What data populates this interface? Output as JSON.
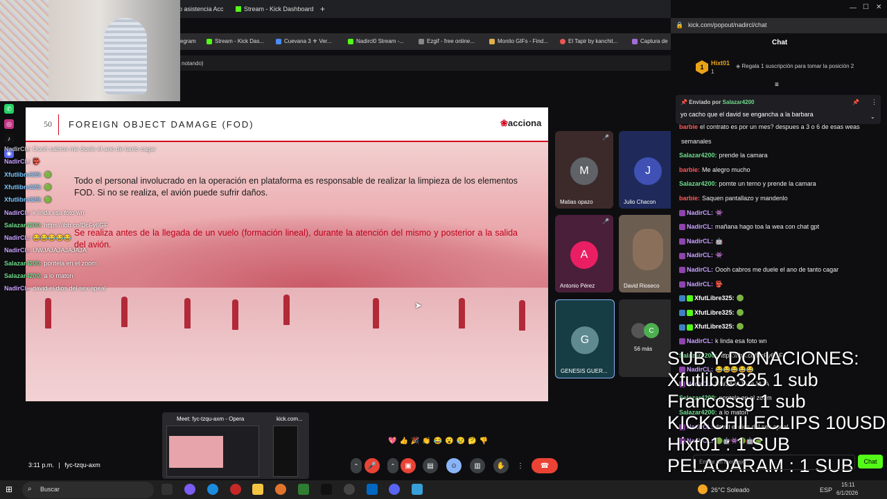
{
  "browser": {
    "tabs": [
      "o asistencia Acc",
      "Stream - Kick Dashboard",
      "+"
    ],
    "bookmarks": [
      "egram",
      "Stream - Kick Das...",
      "Cuevana 3 ⚜ Ver...",
      "Nadircl0 Stream -...",
      "Ezgif - free online...",
      "Monito GIFs - Find...",
      "El Tapir by kanchit...",
      "Captura de"
    ],
    "status_text": "notando)",
    "popout_url": "kick.com/popout/nadircl/chat"
  },
  "slide": {
    "page_number": "50",
    "title": "FOREIGN OBJECT DAMAGE (FOD)",
    "logo": "acciona",
    "paragraph1": "Todo el personal involucrado en la operación en plataforma es responsable de realizar la limpieza de los elementos FOD. Si no se realiza, el avión puede sufrir daños.",
    "paragraph2": "Se realiza antes de la llegada de un vuelo (formación lineal), durante la atención del mismo y posterior a la salida del avión."
  },
  "stream_chat_overlay": [
    {
      "name": "NadirCL:",
      "text": "Oooh cabros me duele el ano de tanto cagar",
      "color": "#bbbbbb"
    },
    {
      "name": "NadirCL:",
      "text": "👺",
      "color": "#c9a0ff"
    },
    {
      "name": "Xfutlibre325:",
      "text": "🟢",
      "color": "#7ec8ff"
    },
    {
      "name": "Xfutlibre325:",
      "text": "🟢",
      "color": "#7ec8ff"
    },
    {
      "name": "Xfutlibre325:",
      "text": "🟢",
      "color": "#7ec8ff"
    },
    {
      "name": "NadirCL:",
      "text": "k linda esa foto wn",
      "color": "#c9a0ff"
    },
    {
      "name": "Salazar4200:",
      "text": "https://ibb.co/DcFy6GF",
      "color": "#6fdc8c"
    },
    {
      "name": "NadirCL:",
      "text": "😂😂😂😂😂",
      "color": "#c9a0ff"
    },
    {
      "name": "NadirCL:",
      "text": "UWJAJAJAJAJAJA",
      "color": "#c9a0ff"
    },
    {
      "name": "Salazar4200:",
      "text": "pontela en el zoom",
      "color": "#6fdc8c"
    },
    {
      "name": "Salazar4200:",
      "text": "a lo maton",
      "color": "#6fdc8c"
    },
    {
      "name": "NadirCL:",
      "text": "david el dios del sex apeal",
      "color": "#c9a0ff"
    }
  ],
  "participants": [
    {
      "name": "Matias opazo",
      "initial": "M",
      "bg": "#3c2a2a",
      "avatar_color": "#5f6368"
    },
    {
      "name": "Julio Chacon",
      "initial": "J",
      "bg": "#1f2a5a",
      "avatar_color": "#3f51b5"
    },
    {
      "name": "Antonio Pérez",
      "initial": "A",
      "bg": "#4a1f3a",
      "avatar_color": "#e91e63"
    },
    {
      "name": "David Rioseco",
      "initial": "",
      "bg": "#6b5d50",
      "avatar_color": "#6b5d50"
    },
    {
      "name": "GENESIS GUER...",
      "initial": "G",
      "bg": "#163c44",
      "avatar_color": "#5f8a90"
    },
    {
      "name": "56 más",
      "initial": "C",
      "bg": "#2a2a2a",
      "avatar_color": "#4caf50"
    }
  ],
  "meet": {
    "time": "3:11 p.m.",
    "separator": "|",
    "meeting_code": "fyc-tzqu-axm",
    "reactions": [
      "💖",
      "👍",
      "🎉",
      "👏",
      "😂",
      "😮",
      "😢",
      "🤔",
      "👎"
    ],
    "preview_title1": "Meet: fyc-tzqu-axm - Opera",
    "preview_title2": "kick.com..."
  },
  "chat": {
    "title": "Chat",
    "top_gifter": {
      "name": "Hixt01",
      "count": "1",
      "rank": "1"
    },
    "gift_prompt": "Regala 1 suscripción para tomar la posición 2",
    "pinned": {
      "label": "Enviado por",
      "by": "Salazar4200",
      "text": "yo cacho que el david se engancha a la barbara"
    },
    "messages": [
      {
        "name": "barbie",
        "text": "el contrato es por un mes? despues a 3 o 6 de esas weas",
        "color": "#ff5a5a"
      },
      {
        "name": "",
        "text": "semanales",
        "color": "#ffffff"
      },
      {
        "name": "Salazar4200:",
        "text": "prende la camara",
        "color": "#6fdc8c"
      },
      {
        "name": "barbie:",
        "text": "Me alegro mucho",
        "color": "#ff5a5a"
      },
      {
        "name": "Salazar4200:",
        "text": "pomte un terno y prende la camara",
        "color": "#6fdc8c"
      },
      {
        "name": "barbie:",
        "text": "Saquen pantallazo y mandenlo",
        "color": "#ff5a5a"
      },
      {
        "name": "NadirCL:",
        "text": "👾",
        "color": "#c9a0ff"
      },
      {
        "name": "NadirCL:",
        "text": "mañana hago toa la wea con chat gpt",
        "color": "#c9a0ff"
      },
      {
        "name": "NadirCL:",
        "text": "🤖",
        "color": "#c9a0ff"
      },
      {
        "name": "NadirCL:",
        "text": "👾",
        "color": "#c9a0ff"
      },
      {
        "name": "NadirCL:",
        "text": "Oooh cabros me duele el ano de tanto cagar",
        "color": "#c9a0ff"
      },
      {
        "name": "NadirCL:",
        "text": "👺",
        "color": "#c9a0ff"
      },
      {
        "name": "XfutLibre325:",
        "text": "🟢",
        "color": "#ffffff"
      },
      {
        "name": "XfutLibre325:",
        "text": "🟢",
        "color": "#ffffff"
      },
      {
        "name": "XfutLibre325:",
        "text": "🟢",
        "color": "#ffffff"
      },
      {
        "name": "NadirCL:",
        "text": "k linda esa foto wn",
        "color": "#c9a0ff"
      },
      {
        "name": "Salazar4200:",
        "text": "https://ibb.co/DcFy6GF",
        "color": "#6fdc8c"
      },
      {
        "name": "NadirCL:",
        "text": "😂😂😂😂😂",
        "color": "#c9a0ff"
      },
      {
        "name": "NadirCL:",
        "text": "UWJAJAJAJAJAJA",
        "color": "#c9a0ff"
      },
      {
        "name": "Salazar4200:",
        "text": "pontela en el zoom",
        "color": "#6fdc8c"
      },
      {
        "name": "Salazar4200:",
        "text": "a lo maton",
        "color": "#6fdc8c"
      },
      {
        "name": "NadirCL:",
        "text": "david el dios del sex apeal",
        "color": "#c9a0ff"
      },
      {
        "name": "NadirCL:",
        "text": "🟢🤖👾🟢🤖🟢",
        "color": "#c9a0ff"
      }
    ],
    "input_placeholder": "Enviar un mensaje",
    "chat_button": "Chat"
  },
  "overlay_subs": {
    "heading": "SUB Y DONACIONES:",
    "lines": [
      "Xfutlibre325 1 sub",
      "Francossg 1 sub",
      "KICKCHILECLIPS 10USD",
      "Hixt01 : 1 SUB",
      "PELAOARAM : 1 SUB"
    ]
  },
  "taskbar": {
    "search": "Buscar",
    "weather": "26°C  Soleado",
    "lang": "ESP",
    "time": "15:11",
    "date": "6/1/2026"
  },
  "colors": {
    "kick_green": "#53fc18",
    "meet_red": "#ea4335",
    "accent_red": "#d0011b"
  }
}
